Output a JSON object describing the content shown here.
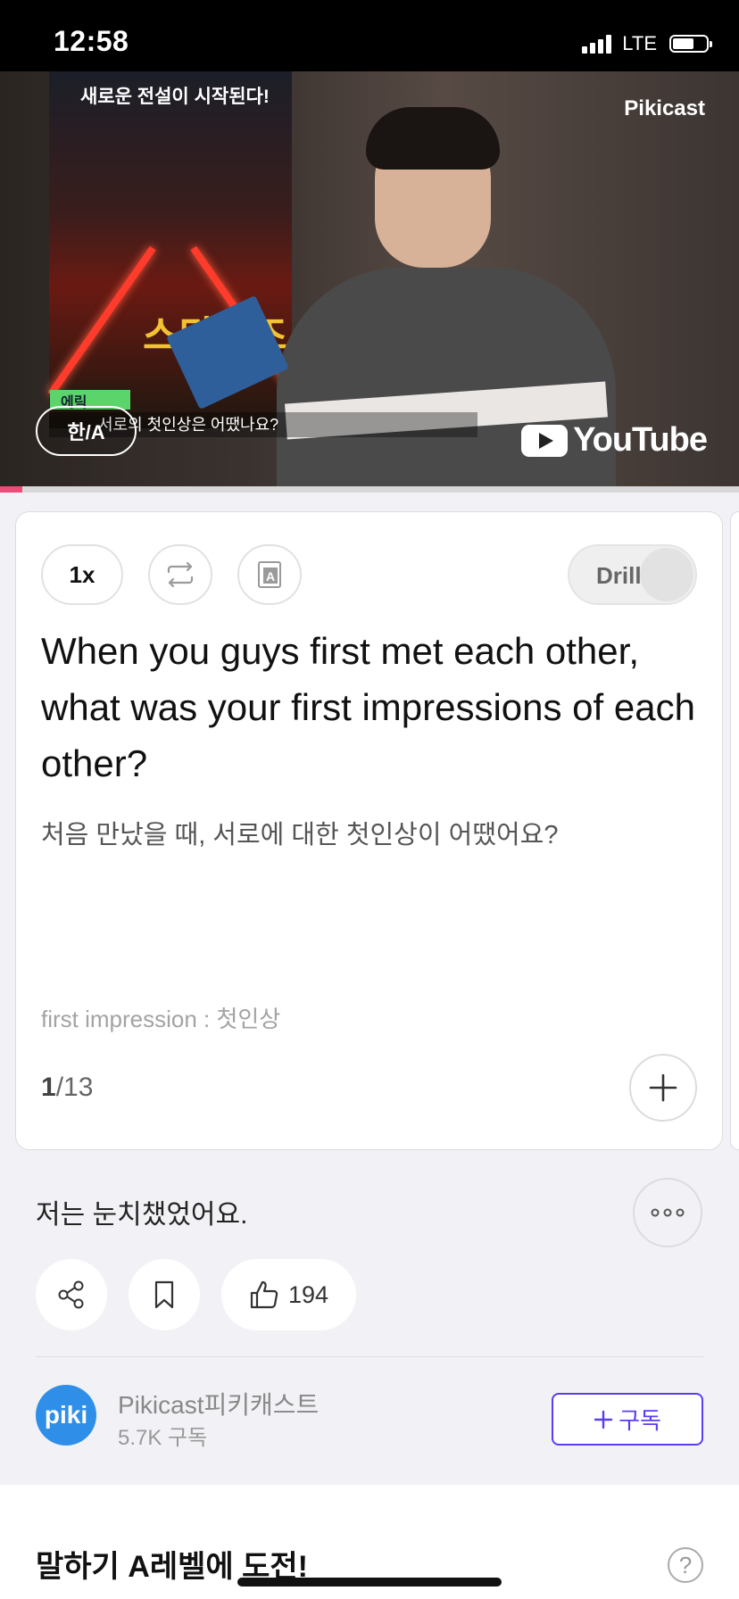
{
  "status_bar": {
    "time": "12:58",
    "network": "LTE",
    "battery_percent": 65
  },
  "video": {
    "poster_title": "새로운 전설이 시작된다!",
    "poster_logo": "스타워즈",
    "name_tag": "에릭",
    "subtitle": "서로의 첫인상은 어땠나요?",
    "watermark": "Pikicast",
    "lang_toggle_label": "한/A",
    "youtube_label": "YouTube",
    "progress_fraction": 0.03,
    "progress_color": "#f04b78"
  },
  "controls": {
    "speed_label": "1x",
    "drill_label": "Drill"
  },
  "card": {
    "english_sentence": "When you guys first met each other, what was your first impressions of each other?",
    "korean_sentence": "처음 만났을 때, 서로에 대한 첫인상이 어땠어요?",
    "vocab": "first impression : 첫인상",
    "counter_current": "1",
    "counter_total": "/13"
  },
  "reply": {
    "text": "저는 눈치챘었어요."
  },
  "actions": {
    "like_count": "194"
  },
  "channel": {
    "avatar_text": "piki",
    "name": "Pikicast피키캐스트",
    "subscribers": "5.7K 구독",
    "subscribe_label": "구독",
    "accent_color": "#5b3df0"
  },
  "challenge": {
    "title": "말하기 A레벨에 도전!"
  }
}
